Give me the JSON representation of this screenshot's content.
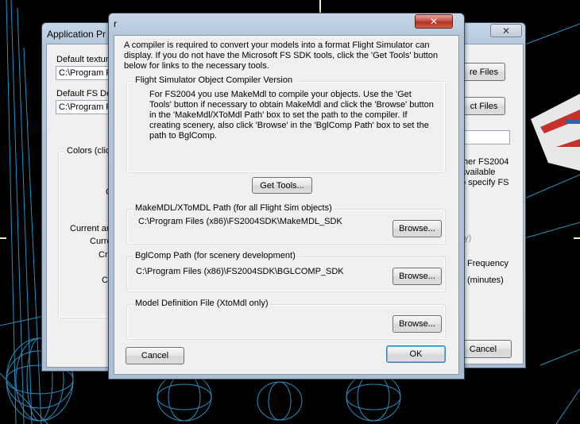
{
  "back_left_window": {
    "title": "Application Pr",
    "default_texture_label": "Default textur",
    "default_texture_value": "C:\\Program F",
    "default_fs_label": "Default FS De",
    "default_fs_value": "C:\\Program F",
    "colors_group_label": "Colors (click",
    "partial_labels": [
      "C",
      "Current ar",
      "Curre",
      "Cr",
      "C"
    ]
  },
  "back_right_window": {
    "close_glyph": "✕",
    "buttons": {
      "files1": "re Files",
      "files2": "ct Files",
      "cancel": "Cancel"
    },
    "text_lines": [
      "ther FS2004",
      "available",
      "o specify FS"
    ],
    "bracket_text": "y)",
    "frequency": "Frequency",
    "minutes": "(minutes)"
  },
  "dialog": {
    "title": "r",
    "close_glyph": "✕",
    "intro": "A compiler is required to convert your models into a format Flight Simulator can display.  If you do not have the Microsoft FS SDK tools, click the 'Get Tools' button below for links to the necessary tools.",
    "version_group": {
      "label": "Flight Simulator Object Compiler Version",
      "text": "For FS2004 you use MakeMdl to compile your objects. Use the 'Get Tools' button if necessary to obtain MakeMdl and click the 'Browse' button in the 'MakeMdl/XToMdl Path' box to set the path to the compiler. If creating scenery, also click 'Browse' in the 'BglComp Path' box to set the path to BglComp."
    },
    "get_tools_label": "Get Tools...",
    "makemdl_group": {
      "label": "MakeMDL/XToMDL Path (for all Flight Sim objects)",
      "path": "C:\\Program Files (x86)\\FS2004SDK\\MakeMDL_SDK",
      "browse": "Browse..."
    },
    "bglcomp_group": {
      "label": "BglComp Path (for scenery development)",
      "path": "C:\\Program Files (x86)\\FS2004SDK\\BGLCOMP_SDK",
      "browse": "Browse..."
    },
    "model_def_group": {
      "label": "Model Definition File (XtoMdl only)",
      "path": "",
      "browse": "Browse..."
    },
    "cancel_label": "Cancel",
    "ok_label": "OK"
  }
}
